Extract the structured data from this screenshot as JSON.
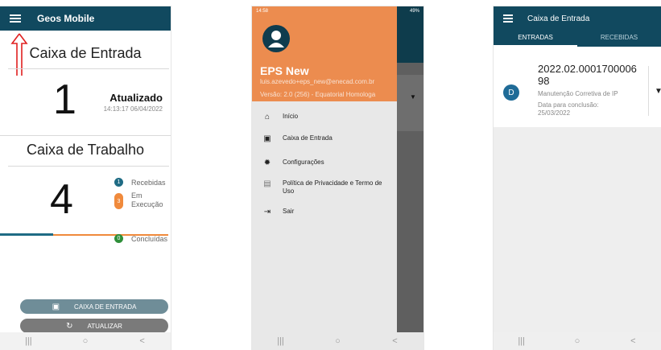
{
  "screen1": {
    "app_title": "Geos Mobile",
    "inbox_title": "Caixa de Entrada",
    "inbox_count": "1",
    "updated_label": "Atualizado",
    "updated_time": "14:13:17 06/04/2022",
    "work_title": "Caixa de Trabalho",
    "work_count": "4",
    "statuses": [
      {
        "badge": "1",
        "label": "Recebidas",
        "color": "#1f6b84"
      },
      {
        "badge": "3",
        "label": "Em\nExecução",
        "color": "#f08a3c"
      },
      {
        "badge": "0",
        "label": "Concluídas",
        "color": "#2f8f3a"
      }
    ],
    "buttons": [
      {
        "label": "CAIXA DE ENTRADA",
        "icon": "inbox-icon",
        "color": "#6f8d98"
      },
      {
        "label": "ATUALIZAR",
        "icon": "refresh-icon",
        "color": "#7a7a7a"
      }
    ],
    "annotation_color": "#e02020"
  },
  "screen2": {
    "status_time": "14:58",
    "status_right": "49%",
    "user_name": "EPS New",
    "user_email": "luis.azevedo+eps_new@enecad.com.br",
    "version": "Versão: 2.0 (256) - Equatorial Homologa",
    "menu": [
      {
        "label": "Início",
        "icon": "home-icon"
      },
      {
        "label": "Caixa de Entrada",
        "icon": "inbox-icon"
      },
      {
        "label": "Configurações",
        "icon": "gear-icon"
      },
      {
        "label": "Política de Privacidade e Termo de Uso",
        "icon": "document-icon"
      },
      {
        "label": "Sair",
        "icon": "logout-icon"
      }
    ],
    "header_color": "#ec8c4f"
  },
  "screen3": {
    "app_title": "Caixa de Entrada",
    "tabs": [
      {
        "label": "ENTRADAS",
        "active": true
      },
      {
        "label": "RECEBIDAS",
        "active": false
      }
    ],
    "item": {
      "avatar_letter": "D",
      "number": "2022.02.000170000698",
      "service": "Manutenção Corretiva de IP",
      "due_label": "Data para conclusão:",
      "due_date": "25/03/2022"
    }
  },
  "nav_glyphs": [
    "|||",
    "○",
    "<"
  ]
}
